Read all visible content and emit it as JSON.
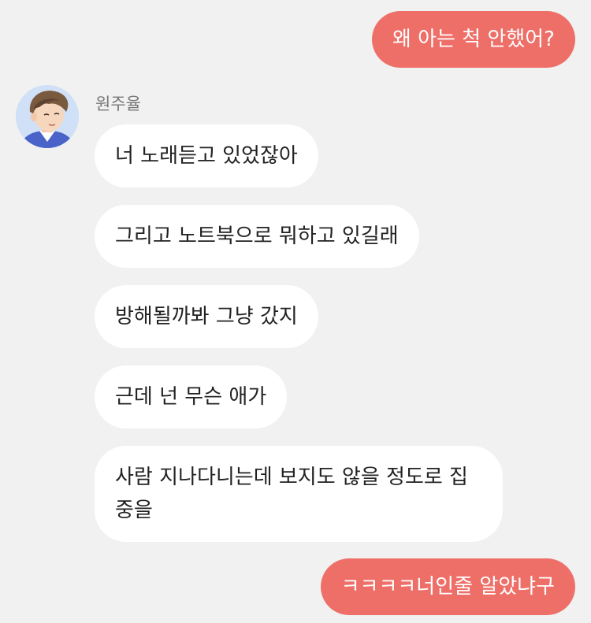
{
  "colors": {
    "background": "#f1f1f1",
    "incoming_bubble": "#ffffff",
    "outgoing_bubble": "#ee6f68",
    "incoming_text": "#222222",
    "outgoing_text": "#ffffff",
    "sender_name": "#777777"
  },
  "contact": {
    "name": "원주율",
    "avatar_icon": "avatar-illustration-boy"
  },
  "messages": [
    {
      "from": "me",
      "text": "왜 아는 척 안했어?"
    },
    {
      "from": "contact",
      "text": "너 노래듣고 있었잖아"
    },
    {
      "from": "contact",
      "text": "그리고 노트북으로 뭐하고 있길래"
    },
    {
      "from": "contact",
      "text": "방해될까봐 그냥 갔지"
    },
    {
      "from": "contact",
      "text": "근데 넌 무슨 애가"
    },
    {
      "from": "contact",
      "text": "사람 지나다니는데 보지도 않을 정도로 집중을"
    },
    {
      "from": "me",
      "text": "ㅋㅋㅋㅋ너인줄 알았냐구"
    }
  ]
}
